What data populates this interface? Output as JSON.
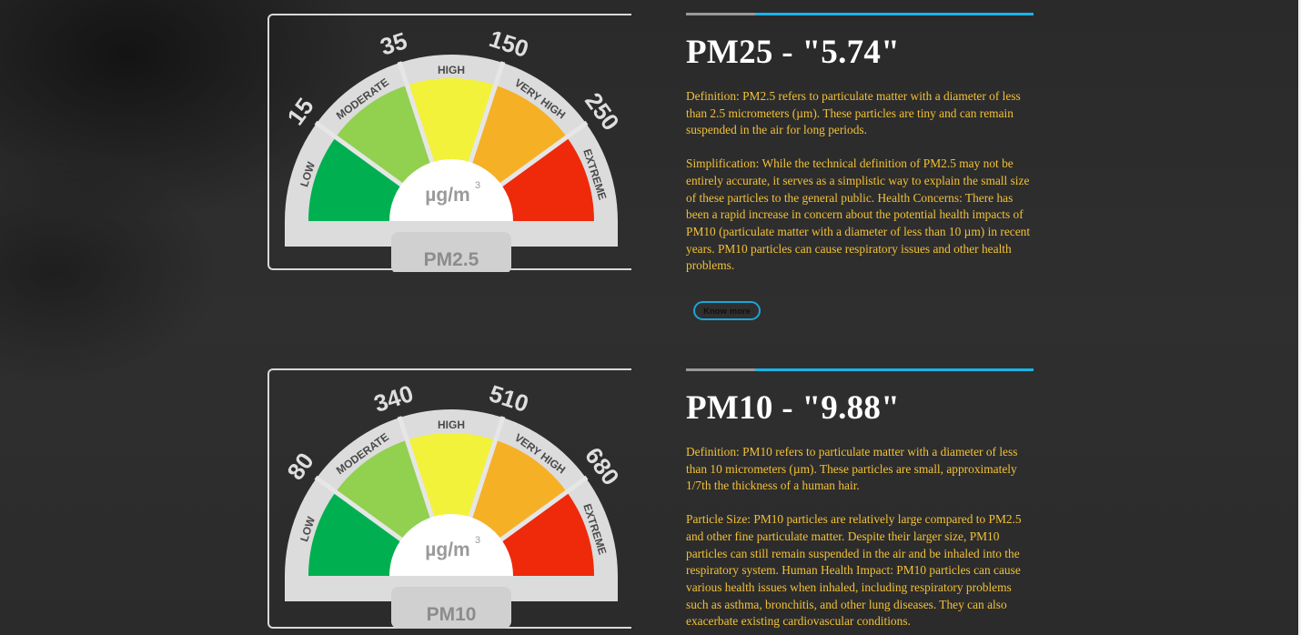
{
  "sections": [
    {
      "title": "PM25 - \"5.74\"",
      "paragraphs": [
        "Definition: PM2.5 refers to particulate matter with a diameter of less than 2.5 micrometers (µm). These particles are tiny and can remain suspended in the air for long periods.",
        "Simplification: While the technical definition of PM2.5 may not be entirely accurate, it serves as a simplistic way to explain the small size of these particles to the general public. Health Concerns: There has been a rapid increase in concern about the potential health impacts of PM10 (particulate matter with a diameter of less than 10 µm) in recent years. PM10 particles can cause respiratory issues and other health problems."
      ],
      "button_label": "Know more",
      "gauge": {
        "label": "PM2.5",
        "unit": "µg/m",
        "unit_sup": "3",
        "thresholds": [
          "15",
          "35",
          "150",
          "250"
        ],
        "bands": [
          "LOW",
          "MODERATE",
          "HIGH",
          "VERY HIGH",
          "EXTREME"
        ]
      }
    },
    {
      "title": "PM10 - \"9.88\"",
      "paragraphs": [
        "Definition: PM10 refers to particulate matter with a diameter of less than 10 micrometers (µm). These particles are small, approximately 1/7th the thickness of a human hair.",
        "Particle Size: PM10 particles are relatively large compared to PM2.5 and other fine particulate matter. Despite their larger size, PM10 particles can still remain suspended in the air and be inhaled into the respiratory system. Human Health Impact: PM10 particles can cause various health issues when inhaled, including respiratory problems such as asthma, bronchitis, and other lung diseases. They can also exacerbate existing cardiovascular conditions."
      ],
      "gauge": {
        "label": "PM10",
        "unit": "µg/m",
        "unit_sup": "3",
        "thresholds": [
          "80",
          "340",
          "510",
          "680"
        ],
        "bands": [
          "LOW",
          "MODERATE",
          "HIGH",
          "VERY HIGH",
          "EXTREME"
        ]
      }
    }
  ],
  "colors": {
    "low": "#00b050",
    "moderate": "#92d050",
    "high": "#f2f23a",
    "very_high": "#f6b026",
    "extreme": "#ee2a0a",
    "accent": "#1ab4e8",
    "text": "#f2c037"
  }
}
